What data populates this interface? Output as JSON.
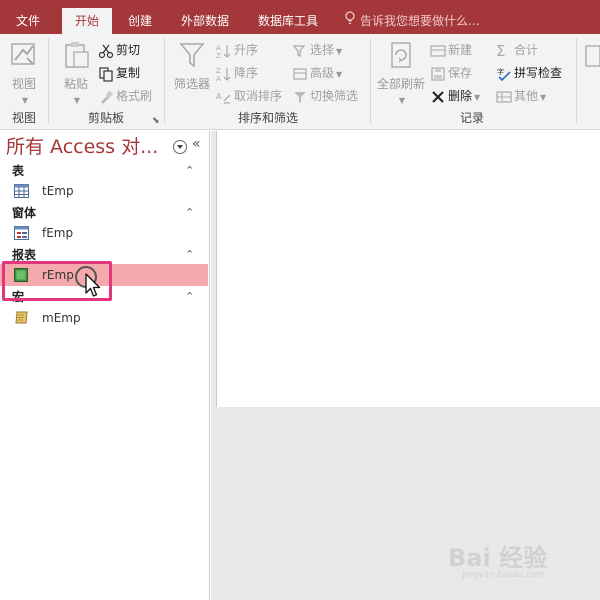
{
  "tabs": [
    "文件",
    "开始",
    "创建",
    "外部数据",
    "数据库工具"
  ],
  "active_tab": "开始",
  "tell_me": "告诉我您想要做什么...",
  "ribbon": {
    "view": {
      "label": "视图",
      "group": "视图"
    },
    "clipboard": {
      "paste": "粘贴",
      "cut": "剪切",
      "copy": "复制",
      "format_painter": "格式刷",
      "group": "剪贴板"
    },
    "sort_filter": {
      "filter": "筛选器",
      "ascending": "升序",
      "descending": "降序",
      "clear_sort": "取消排序",
      "selection": "选择",
      "advanced": "高级",
      "toggle_filter": "切换筛选",
      "group": "排序和筛选"
    },
    "records": {
      "refresh_all": "全部刷新",
      "new": "新建",
      "save": "保存",
      "delete": "删除",
      "totals": "合计",
      "spelling": "拼写检查",
      "more": "其他",
      "group": "记录"
    }
  },
  "nav_pane": {
    "title": "所有 Access 对...",
    "categories": [
      {
        "label": "表",
        "items": [
          "tEmp"
        ]
      },
      {
        "label": "窗体",
        "items": [
          "fEmp"
        ]
      },
      {
        "label": "报表",
        "items": [
          "rEmp"
        ]
      },
      {
        "label": "宏",
        "items": [
          "mEmp"
        ]
      }
    ],
    "selected_item": "rEmp"
  },
  "watermark": {
    "main": "Bai 经验",
    "sub": "jingyan.baidu.com"
  },
  "colors": {
    "accent": "#a4373a",
    "ribbon_bg": "#f3f3f3",
    "selection": "#f6a9ad",
    "highlight": "#e2367c"
  }
}
